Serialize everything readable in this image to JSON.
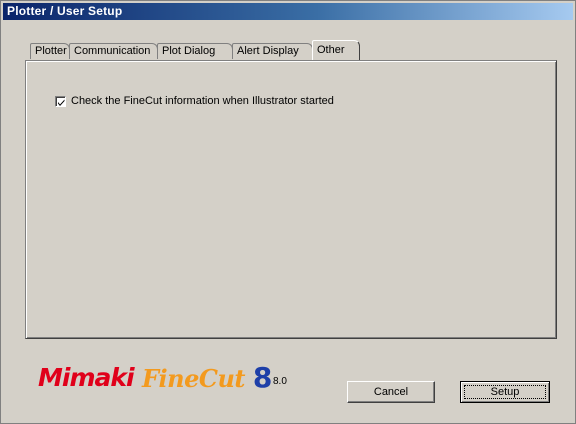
{
  "window": {
    "title": "Plotter / User Setup"
  },
  "tabs": [
    {
      "label": "Plotter",
      "active": false
    },
    {
      "label": "Communication",
      "active": false
    },
    {
      "label": "Plot Dialog",
      "active": false
    },
    {
      "label": "Alert Display",
      "active": false
    },
    {
      "label": "Other",
      "active": true
    }
  ],
  "options": {
    "check_finecut_label": "Check the FineCut information when Illustrator started",
    "check_finecut_checked": true
  },
  "branding": {
    "mimaki": "Mimaki",
    "finecut_text": "FineCut",
    "finecut_number": "8",
    "version": "8.0",
    "colors": {
      "mimaki": "#e0001a",
      "finecut": "#f39a1e",
      "eight": "#1e3fa8"
    }
  },
  "buttons": {
    "cancel": "Cancel",
    "setup": "Setup"
  },
  "colors": {
    "titlebar_start": "#0a246a",
    "titlebar_end": "#a6caf0",
    "face": "#d4d0c8"
  }
}
